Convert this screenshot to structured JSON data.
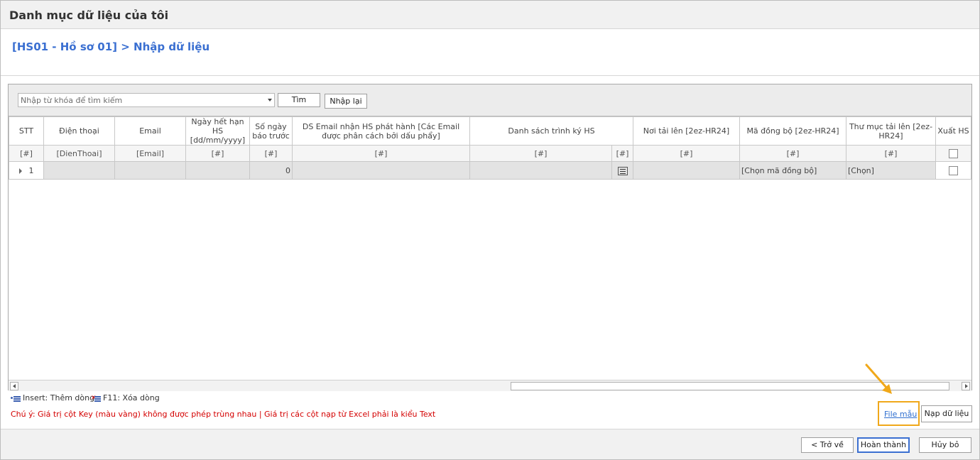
{
  "window": {
    "title": "Danh mục dữ liệu của tôi"
  },
  "breadcrumb": "[HS01 - Hồ sơ 01] > Nhập dữ liệu",
  "search": {
    "placeholder": "Nhập từ khóa để tìm kiếm",
    "search_label": "Tìm",
    "reset_label": "Nhập lại"
  },
  "grid": {
    "headers": {
      "stt": "STT",
      "dienthoai": "Điện thoại",
      "email": "Email",
      "ngayhethan": "Ngày hết hạn HS [dd/mm/yyyy]",
      "songay": "Số ngày báo trước",
      "dsemail": "DS Email nhận HS phát hành [Các Email được phân cách bởi dấu phẩy]",
      "danhsachky": "Danh sách trình ký HS",
      "noitai": "Nơi tải lên [2ez-HR24]",
      "madongbo": "Mã đồng bộ [2ez-HR24]",
      "thumuc": "Thư mục tải lên [2ez-HR24]",
      "xuat": "Xuất HS"
    },
    "filters": {
      "stt": "[#]",
      "dienthoai": "[DienThoai]",
      "email": "[Email]",
      "ngayhethan": "[#]",
      "songay": "[#]",
      "dsemail": "[#]",
      "danhsachky": "[#]",
      "danhsachky_btn": "[#]",
      "noitai": "[#]",
      "madongbo": "[#]",
      "thumuc": "[#]"
    },
    "rows": [
      {
        "stt": "1",
        "dienthoai": "",
        "email": "",
        "ngayhethan": "",
        "songay": "0",
        "dsemail": "",
        "danhsachky": "",
        "noitai": "",
        "madongbo": "[Chọn mã đồng bộ]",
        "thumuc": "[Chọn]",
        "xuat": false
      }
    ]
  },
  "hints": {
    "insert": "Insert: Thêm dòng",
    "delete": "F11: Xóa dòng"
  },
  "note": "Chú ý: Giá trị cột Key (màu vàng) không được phép trùng nhau | Giá trị các cột nạp từ Excel phải là kiểu Text",
  "actions": {
    "file_mau": "File mẫu",
    "nap_du_lieu": "Nạp dữ liệu",
    "tro_ve": "< Trở về",
    "hoan_thanh": "Hoàn thành",
    "huy_bo": "Hủy bỏ"
  },
  "colors": {
    "accent": "#3a6fd1",
    "highlight": "#f0a81a",
    "note": "#d40000"
  }
}
